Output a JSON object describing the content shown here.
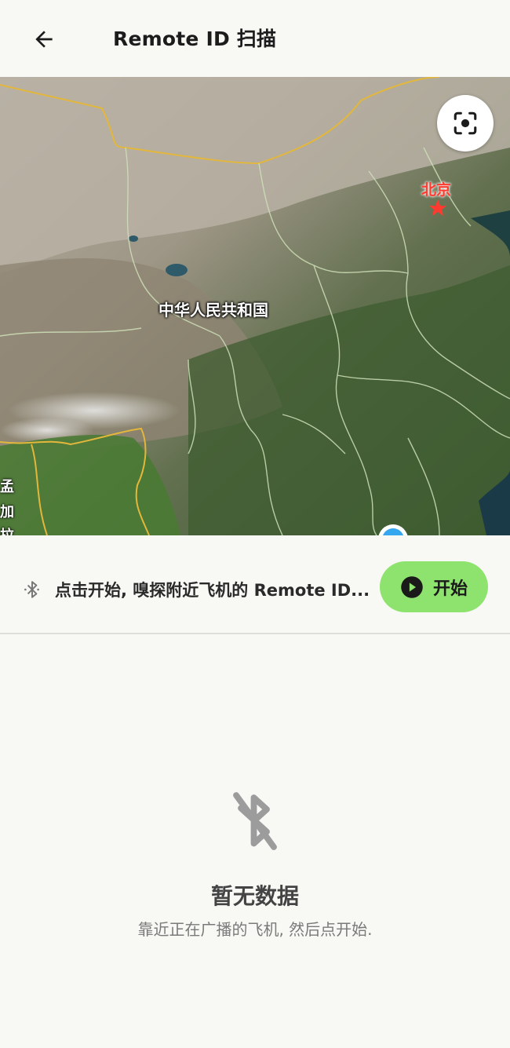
{
  "appbar": {
    "back_icon": "arrow-left-icon",
    "title": "Remote ID 扫描"
  },
  "map": {
    "country_label": "中华人民共和国",
    "capital_label": "北京",
    "edge_labels": [
      "孟",
      "加",
      "拉"
    ],
    "locate_icon": "locate-target-icon",
    "colors": {
      "border_yellow": "#e3b73c",
      "border_province": "#cfe0b8",
      "capital_red": "#ff3b30",
      "marker_blue": "#35a7ef"
    }
  },
  "scan": {
    "bluetooth_icon": "bluetooth-icon",
    "message": "点击开始, 嗅探附近飞机的 Remote ID...",
    "start_label": "开始",
    "start_icon": "play-circle-icon",
    "start_color": "#8ee36e"
  },
  "empty": {
    "icon": "bluetooth-off-icon",
    "title": "暂无数据",
    "subtitle": "靠近正在广播的飞机, 然后点开始."
  }
}
